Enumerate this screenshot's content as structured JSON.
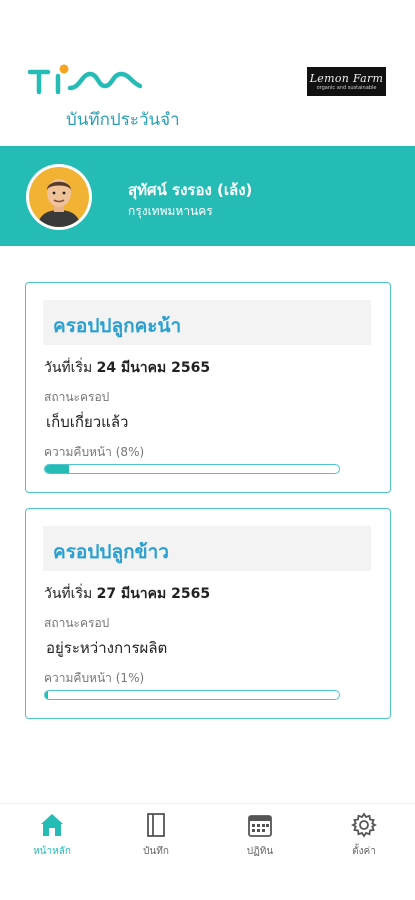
{
  "header": {
    "app_subtitle": "บันทึกประวันจำ",
    "partner_logo": {
      "name": "Lemon Farm",
      "tagline": "organic and sustainable"
    }
  },
  "profile": {
    "name": "สุทัศน์ รงรอง (เล้ง)",
    "location": "กรุงเทพมหานคร"
  },
  "labels": {
    "start_date": "วันที่เริ่ม",
    "status": "สถานะครอป",
    "progress": "ความคืบหน้า"
  },
  "crops": [
    {
      "title": "ครอปปลูกคะน้า",
      "start_date": "24 มีนาคม 2565",
      "status": "เก็บเกี่ยวแล้ว",
      "progress_text": "(8%)",
      "progress": 8
    },
    {
      "title": "ครอปปลูกข้าว",
      "start_date": "27 มีนาคม 2565",
      "status": "อยู่ระหว่างการผลิต",
      "progress_text": "(1%)",
      "progress": 1
    }
  ],
  "nav": [
    {
      "label": "หน้าหลัก",
      "icon": "home-icon",
      "active": true
    },
    {
      "label": "บันทึก",
      "icon": "notebook-icon",
      "active": false
    },
    {
      "label": "ปฏิทิน",
      "icon": "calendar-icon",
      "active": false
    },
    {
      "label": "ตั้งค่า",
      "icon": "gear-icon",
      "active": false
    }
  ],
  "colors": {
    "accent": "#26bcb6",
    "title_blue": "#2a9fd0",
    "card_border": "#4fc3cf"
  }
}
